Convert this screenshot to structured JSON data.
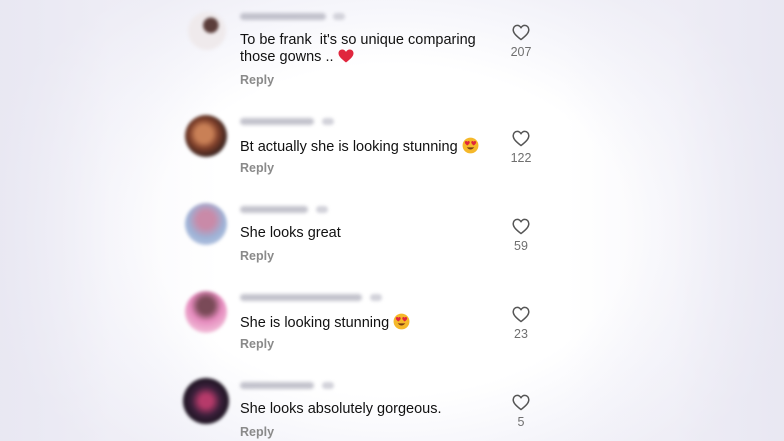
{
  "comments": [
    {
      "text": "To be frank  it's so unique comparing those gowns .. ",
      "emoji": "red-heart",
      "reply_label": "Reply",
      "like_count": "207",
      "avatar_colors": [
        "#f1eef0",
        "#5b3d3a"
      ]
    },
    {
      "text": "Bt actually she is looking stunning ",
      "emoji": "heart-eyes",
      "reply_label": "Reply",
      "like_count": "122",
      "avatar_colors": [
        "#b46f4e",
        "#3a2420"
      ]
    },
    {
      "text": "She looks great",
      "emoji": "",
      "reply_label": "Reply",
      "like_count": "59",
      "avatar_colors": [
        "#9fb2d8",
        "#c77fa1"
      ]
    },
    {
      "text": "She is looking stunning ",
      "emoji": "heart-eyes",
      "reply_label": "Reply",
      "like_count": "23",
      "avatar_colors": [
        "#e07ab4",
        "#7a4a58"
      ]
    },
    {
      "text": "She looks absolutely gorgeous.",
      "emoji": "",
      "reply_label": "Reply",
      "like_count": "5",
      "avatar_colors": [
        "#2a1f3a",
        "#b63a6a"
      ]
    }
  ],
  "icons": {
    "like": "heart-outline-icon",
    "emoji_red_heart": "red-heart-emoji",
    "emoji_heart_eyes": "heart-eyes-emoji"
  },
  "colors": {
    "text": "#111111",
    "secondary_text": "#8a8a8a",
    "count_text": "#6f6f6f",
    "emoji_heart": "#e0263d",
    "emoji_face": "#f5b82a"
  }
}
